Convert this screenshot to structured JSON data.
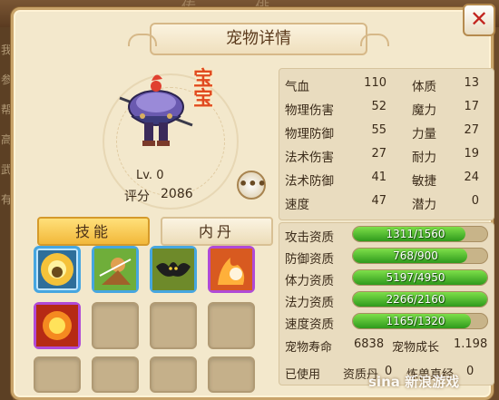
{
  "background": {
    "top_ghost": "传 俳",
    "left_ghost": [
      "我",
      "参",
      "帮",
      "高",
      "武",
      "有"
    ]
  },
  "title": "宠物详情",
  "close_label": "✕",
  "pet": {
    "badge": "宝宝",
    "level": "Lv. 0",
    "score_label": "评分",
    "score_value": "2086"
  },
  "chat_label": "•••",
  "tabs": {
    "skill": "技能",
    "core": "内丹"
  },
  "stats_left": [
    {
      "label": "气血",
      "value": "110"
    },
    {
      "label": "物理伤害",
      "value": "52"
    },
    {
      "label": "物理防御",
      "value": "55"
    },
    {
      "label": "法术伤害",
      "value": "27"
    },
    {
      "label": "法术防御",
      "value": "41"
    },
    {
      "label": "速度",
      "value": "47"
    }
  ],
  "stats_right": [
    {
      "label": "体质",
      "value": "13"
    },
    {
      "label": "魔力",
      "value": "17"
    },
    {
      "label": "力量",
      "value": "27"
    },
    {
      "label": "耐力",
      "value": "19"
    },
    {
      "label": "敏捷",
      "value": "24"
    },
    {
      "label": "潜力",
      "value": "0"
    }
  ],
  "aptitudes": [
    {
      "label": "攻击资质",
      "text": "1311/1560",
      "fraction": 0.84
    },
    {
      "label": "防御资质",
      "text": "768/900",
      "fraction": 0.85
    },
    {
      "label": "体力资质",
      "text": "5197/4950",
      "fraction": 1.0
    },
    {
      "label": "法力资质",
      "text": "2266/2160",
      "fraction": 1.0
    },
    {
      "label": "速度资质",
      "text": "1165/1320",
      "fraction": 0.88
    }
  ],
  "lifespan": {
    "label": "宠物寿命",
    "value": "6838"
  },
  "growth": {
    "label": "宠物成长",
    "value": "1.198"
  },
  "used": {
    "label": "已使用",
    "pill_label": "资质丹",
    "pill_value": "0",
    "essence_label": "炼兽真经",
    "essence_value": "0"
  },
  "watermark": "sina 新浪游戏",
  "colors": {
    "panel": "#f3e8cc",
    "bar_fill": "#3fae24",
    "badge": "#e04a20",
    "skill_tab": "#f2b83a"
  },
  "skills": [
    {
      "icon": "golden-spirit-icon",
      "style": "blue"
    },
    {
      "icon": "green-warrior-icon",
      "style": "blue"
    },
    {
      "icon": "bat-icon",
      "style": "blue"
    },
    {
      "icon": "fire-beast-icon",
      "style": "purple"
    },
    {
      "icon": "flame-burst-icon",
      "style": "purple"
    }
  ]
}
